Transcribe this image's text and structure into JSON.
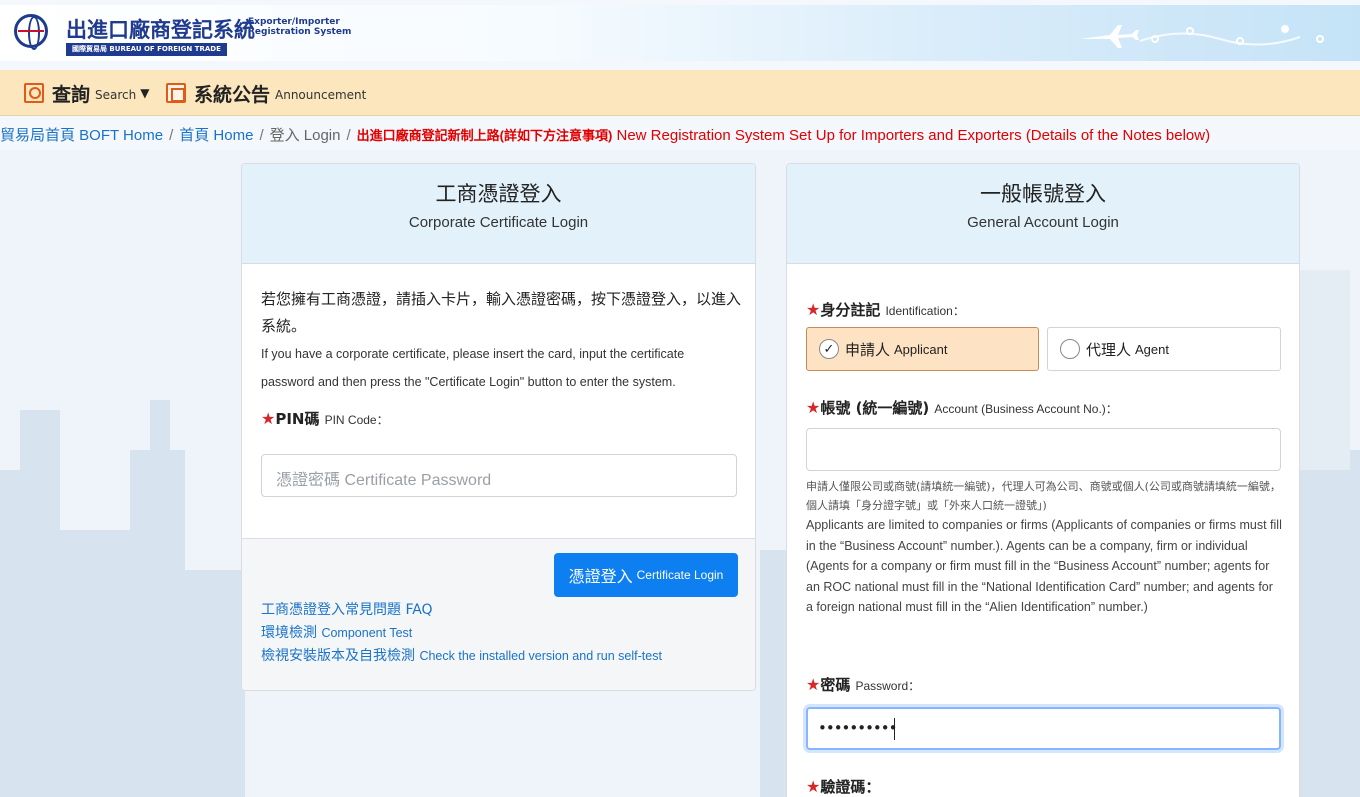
{
  "header": {
    "title_zh": "出進口廠商登記系統",
    "title_en_line1": "Exporter/Importer",
    "title_en_line2": "Registration System",
    "org": "國際貿易局 BUREAU OF FOREIGN TRADE"
  },
  "nav": {
    "search_zh": "查詢",
    "search_en": "Search",
    "announcement_zh": "系統公告",
    "announcement_en": "Announcement"
  },
  "breadcrumb": {
    "home_boft": "貿易局首頁 BOFT Home",
    "home": "首頁 Home",
    "current": "登入 Login",
    "notice_zh": "出進口廠商登記新制上路(詳如下方注意事項)",
    "notice_en": " New Registration System Set Up for Importers and Exporters (Details of the Notes below)"
  },
  "cert_login": {
    "title_zh": "工商憑證登入",
    "title_en": "Corporate Certificate Login",
    "desc_zh": "若您擁有工商憑證，請插入卡片，輸入憑證密碼，按下憑證登入，以進入系統。",
    "desc_en": "If you have a corporate certificate, please insert the card, input the certificate password and then press the \"Certificate Login\" button to enter the system.",
    "pin_label_zh": "PIN碼",
    "pin_label_en": "PIN Code：",
    "pin_placeholder": "憑證密碼 Certificate Password",
    "login_button_zh": "憑證登入",
    "login_button_en": "Certificate Login",
    "link_faq": "工商憑證登入常見問題 FAQ",
    "link_component_zh": "環境檢測",
    "link_component_en": "Component Test",
    "link_selftest_zh": "檢視安裝版本及自我檢測",
    "link_selftest_en": "Check the installed version and run self-test"
  },
  "general_login": {
    "title_zh": "一般帳號登入",
    "title_en": "General Account Login",
    "identity_label_zh": "身分註記",
    "identity_label_en": "Identification：",
    "option_applicant_zh": "申請人",
    "option_applicant_en": "Applicant",
    "option_agent_zh": "代理人",
    "option_agent_en": "Agent",
    "account_label_zh": "帳號 (統一編號)",
    "account_label_en": "Account (Business Account No.)：",
    "account_value": "",
    "account_help_zh": "申請人僅限公司或商號(請填統一編號)，代理人可為公司、商號或個人(公司或商號請填統一編號，個人請填「身分證字號」或「外來人口統一證號」)",
    "account_help_en": "Applicants are limited to companies or firms (Applicants of companies or firms must fill in the “Business Account” number.). Agents can be a company, firm or individual (Agents for a company or firm must fill in the “Business Account” number; agents for an ROC national must fill in the “National Identification Card” number; and agents for a foreign national must fill in the “Alien Identification” number.)",
    "password_label_zh": "密碼",
    "password_label_en": "Password：",
    "password_value": "••••••••••",
    "captcha_label_zh": "驗證碼："
  },
  "colors": {
    "accent": "#1a73c9",
    "button": "#0d7ff0",
    "star": "#d62828",
    "nav_bg": "#fbe6bd",
    "card_head": "#e3f2fa",
    "applicant_selected": "#fde3c3"
  }
}
